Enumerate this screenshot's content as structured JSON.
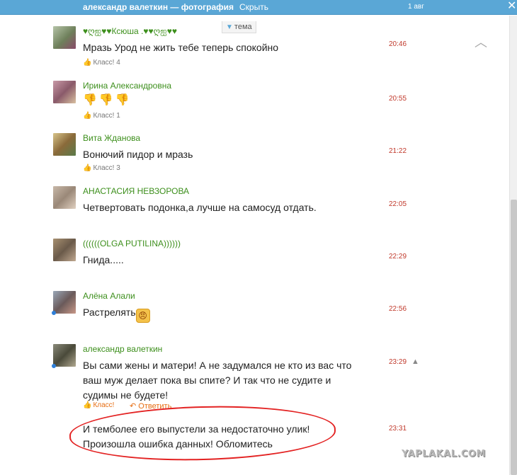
{
  "topbar": {
    "title": "александр валеткин — фотография",
    "hide_label": "Скрыть",
    "date": "1 авг",
    "close_glyph": "✕"
  },
  "tema_label": "тема",
  "collapse_glyph": "︿",
  "comments": [
    {
      "author": "♥ღஐ♥♥Ксюша .♥♥ღஐ♥♥",
      "text": "Мразь Урод не жить тебе теперь спокойно",
      "time": "20:46",
      "likes": "Класс! 4",
      "avatar_color": "#7a8a6a"
    },
    {
      "author": "Ирина Александровна",
      "emoji": [
        "👎",
        "👎",
        "👎"
      ],
      "time": "20:55",
      "likes": "Класс! 1",
      "avatar_color": "#a06a7a"
    },
    {
      "author": "Вита Жданова",
      "text": "Вонючий пидор и мразь",
      "time": "21:22",
      "likes": "Класс! 3",
      "avatar_color": "#8a7a4a"
    },
    {
      "author": "АНАСТАСИЯ НЕВЗОРОВА",
      "text": "Четвертовать подонка,а лучше на самосуд отдать.",
      "time": "22:05",
      "avatar_color": "#9a8a7a"
    },
    {
      "author": "((((((OLGA PUTILINA))))))",
      "text": "Гнида.....",
      "time": "22:29",
      "avatar_color": "#7a6a5a"
    },
    {
      "author": "Алёна Алали",
      "text": "Растрелять",
      "emoji_angry": "😠",
      "time": "22:56",
      "avatar_color": "#6a7a8a"
    },
    {
      "author": "александр валеткин",
      "text_lines": [
        "Вы сами жены и матери! А не задумался не кто из вас что",
        "ваш муж делает пока вы спите? И так что не судите и",
        "судимы не будете!"
      ],
      "time": "23:29",
      "warn": "▲",
      "likes": "Класс!",
      "reply": "Ответить",
      "reply_icon": "↶",
      "avatar_color": "#5a5a4a"
    }
  ],
  "final": {
    "lines": [
      "И темболее его выпустели за недостаточно улик!",
      "Произошла ошибка данных! Обломитесь"
    ],
    "time": "23:31"
  },
  "watermark": "YAPLAKAL.COM",
  "icons": {
    "like": "thumbs-up-icon",
    "reply": "reply-arrow-icon",
    "warning": "warning-triangle-icon",
    "close": "close-icon"
  },
  "colors": {
    "topbar": "#5aa7d6",
    "author": "#3d8f1c",
    "time": "#c0392b",
    "accent": "#e66d12",
    "annotation": "#e32222"
  }
}
